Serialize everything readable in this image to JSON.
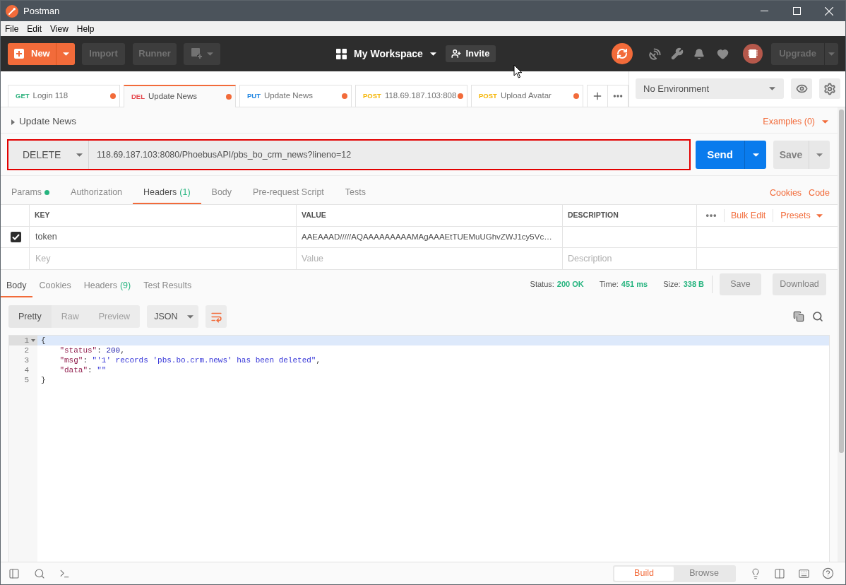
{
  "window": {
    "title": "Postman"
  },
  "menu": [
    "File",
    "Edit",
    "View",
    "Help"
  ],
  "header": {
    "new_button": "New",
    "import_button": "Import",
    "runner_button": "Runner",
    "workspace": "My Workspace",
    "invite_button": "Invite",
    "upgrade_button": "Upgrade"
  },
  "request_tabs": [
    {
      "method": "GET",
      "color": "#2bb17c",
      "name": "Login 118",
      "selected": false,
      "unsaved": true
    },
    {
      "method": "DEL",
      "color": "#e5484d",
      "name": "Update News",
      "selected": true,
      "unsaved": true
    },
    {
      "method": "PUT",
      "color": "#1d84e2",
      "name": "Update News",
      "selected": false,
      "unsaved": true
    },
    {
      "method": "POST",
      "color": "#f5b400",
      "name": "118.69.187.103:808",
      "selected": false,
      "unsaved": true
    },
    {
      "method": "POST",
      "color": "#f5b400",
      "name": "Upload Avatar",
      "selected": false,
      "unsaved": true
    }
  ],
  "environment": {
    "value": "No Environment"
  },
  "request": {
    "name": "Update News",
    "examples": "Examples (0)",
    "method": "DELETE",
    "url": "118.69.187.103:8080/PhoebusAPI/pbs_bo_crm_news?lineno=12",
    "send_button": "Send",
    "save_button": "Save"
  },
  "request_sections": [
    {
      "label": "Params",
      "selected": false,
      "has_values": true
    },
    {
      "label": "Authorization",
      "selected": false,
      "has_values": false
    },
    {
      "label": "Headers",
      "count": "(1)",
      "selected": true,
      "has_values": false
    },
    {
      "label": "Body",
      "selected": false,
      "has_values": false
    },
    {
      "label": "Pre-request Script",
      "selected": false,
      "has_values": false
    },
    {
      "label": "Tests",
      "selected": false,
      "has_values": false
    }
  ],
  "request_links": [
    "Cookies",
    "Code"
  ],
  "headers_table": {
    "columns": [
      "KEY",
      "VALUE",
      "DESCRIPTION"
    ],
    "actions": [
      "Bulk Edit",
      "Presets"
    ],
    "rows": [
      {
        "checked": true,
        "key": "token",
        "value": "AAEAAAD/////AQAAAAAAAAAMAgAAAEtTUEMuUGhvZWJ1cy5Vc…"
      }
    ],
    "new_row": {
      "key": {
        "placeholder": "Key"
      },
      "value": {
        "placeholder": "Value"
      },
      "description": {
        "placeholder": "Description"
      }
    }
  },
  "response": {
    "tabs": [
      {
        "label": "Body",
        "selected": true
      },
      {
        "label": "Cookies",
        "selected": false
      },
      {
        "label": "Headers",
        "count": "(9)",
        "selected": false
      },
      {
        "label": "Test Results",
        "selected": false
      }
    ],
    "stats": [
      {
        "label": "Status:",
        "value": "200 OK"
      },
      {
        "label": "Time:",
        "value": "451 ms"
      },
      {
        "label": "Size:",
        "value": "338 B"
      }
    ],
    "save_button": "Save",
    "download_button": "Download"
  },
  "body_view": {
    "modes": [
      {
        "label": "Pretty",
        "selected": true
      },
      {
        "label": "Raw",
        "selected": false
      },
      {
        "label": "Preview",
        "selected": false
      }
    ],
    "format": "JSON",
    "wrap": true
  },
  "editor": {
    "lines": [
      {
        "number": "1",
        "foldable": true,
        "highlighted": true,
        "tokens": [
          {
            "kind": "punct",
            "text": "{"
          }
        ],
        "children": [
          {
            "number": "2",
            "foldable": false,
            "highlighted": false,
            "tokens": [
              {
                "kind": "key",
                "text": "\"status\""
              },
              {
                "kind": "punct",
                "text": ": "
              },
              {
                "kind": "number",
                "text": "200"
              },
              {
                "kind": "punct",
                "text": ","
              }
            ]
          },
          {
            "number": "3",
            "foldable": false,
            "highlighted": false,
            "tokens": [
              {
                "kind": "key",
                "text": "\"msg\""
              },
              {
                "kind": "punct",
                "text": ": "
              },
              {
                "kind": "string",
                "text": "\"'1' records 'pbs.bo.crm.news' has been deleted\""
              },
              {
                "kind": "punct",
                "text": ","
              }
            ]
          },
          {
            "number": "4",
            "foldable": false,
            "highlighted": false,
            "tokens": [
              {
                "kind": "key",
                "text": "\"data\""
              },
              {
                "kind": "punct",
                "text": ": "
              },
              {
                "kind": "string",
                "text": "\"\""
              }
            ]
          }
        ]
      },
      {
        "number": "5",
        "foldable": false,
        "highlighted": false,
        "tokens": [
          {
            "kind": "punct",
            "text": "}"
          }
        ]
      }
    ]
  },
  "footer": {
    "modes": [
      {
        "label": "Build",
        "selected": true
      },
      {
        "label": "Browse",
        "selected": false
      }
    ]
  }
}
